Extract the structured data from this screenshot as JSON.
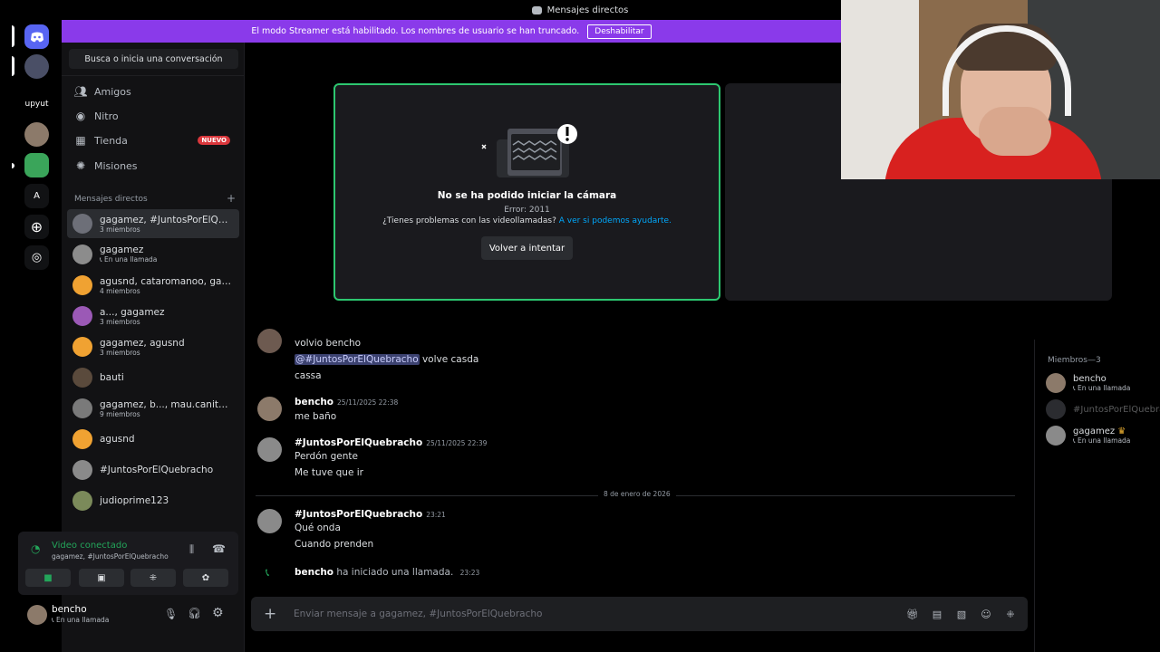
{
  "window": {
    "title": "Mensajes directos"
  },
  "streamer_banner": {
    "text": "El modo Streamer está habilitado. Los nombres de usuario se han truncado.",
    "button": "Deshabilitar"
  },
  "servers": {
    "label_upyut": "upyut",
    "label_a": "A"
  },
  "sidebar": {
    "search": "Busca o inicia una conversación",
    "nav": [
      {
        "label": "Amigos"
      },
      {
        "label": "Nitro"
      },
      {
        "label": "Tienda",
        "badge": "NUEVO"
      },
      {
        "label": "Misiones"
      }
    ],
    "dm_header": "Mensajes directos",
    "dms": [
      {
        "name": "gagamez, #JuntosPorElQuebracho",
        "sub": "3 miembros",
        "color": "#6d6f78"
      },
      {
        "name": "gagamez",
        "sub": "En una llamada",
        "color": "#8c8c8c"
      },
      {
        "name": "agusnd, cataromanoo, gagamez",
        "sub": "4 miembros",
        "color": "#f0a232"
      },
      {
        "name": "a..., gagamez",
        "sub": "3 miembros",
        "color": "#9b59b6"
      },
      {
        "name": "gagamez, agusnd",
        "sub": "3 miembros",
        "color": "#f0a232"
      },
      {
        "name": "bauti",
        "sub": "",
        "color": "#5a4a3c"
      },
      {
        "name": "gagamez, b..., mau.canitano, ...",
        "sub": "9 miembros",
        "color": "#7a7a7a"
      },
      {
        "name": "agusnd",
        "sub": "",
        "color": "#f0a232"
      },
      {
        "name": "#JuntosPorElQuebracho",
        "sub": "",
        "color": "#8a8a8a"
      },
      {
        "name": "judioprime123",
        "sub": "",
        "color": "#7b8a5a"
      }
    ]
  },
  "voice": {
    "status": "Video conectado",
    "channel": "gagamez, #JuntosPorElQuebracho"
  },
  "user": {
    "name": "bencho",
    "status": "En una llamada"
  },
  "call": {
    "camera_error_title": "No se ha podido iniciar la cámara",
    "error_code": "Error: 2011",
    "help_text": "¿Tienes problemas con las videollamadas?",
    "help_link": "A ver si podemos ayudarte.",
    "retry": "Volver a intentar"
  },
  "messages": {
    "cont1": "volvio bencho",
    "mention": "@#JuntosPorElQuebracho",
    "cont2_rest": "volve casda",
    "cont3": "cassa",
    "m1": {
      "author": "bencho",
      "time": "25/11/2025 22:38",
      "lines": [
        "me baño"
      ]
    },
    "m2": {
      "author": "#JuntosPorElQuebracho",
      "time": "25/11/2025 22:39",
      "lines": [
        "Perdón gente",
        "Me tuve que ir"
      ]
    },
    "date_divider": "8 de enero de 2026",
    "m3": {
      "author": "#JuntosPorElQuebracho",
      "time": "23:21",
      "lines": [
        "Qué onda",
        "Cuando prenden"
      ]
    },
    "call_event": {
      "author": "bencho",
      "text": "ha iniciado una llamada.",
      "time": "23:23"
    }
  },
  "input": {
    "placeholder": "Enviar mensaje a gagamez, #JuntosPorElQuebracho"
  },
  "members": {
    "header": "Miembros—3",
    "list": [
      {
        "name": "bencho",
        "sub": "En una llamada"
      },
      {
        "name": "#JuntosPorElQuebracho",
        "sub": ""
      },
      {
        "name": "gagamez",
        "sub": "En una llamada"
      }
    ]
  },
  "colors": {
    "accent": "#5865f2",
    "banner": "#8a3aea",
    "online": "#23a55a",
    "speaking": "#2dc770"
  }
}
